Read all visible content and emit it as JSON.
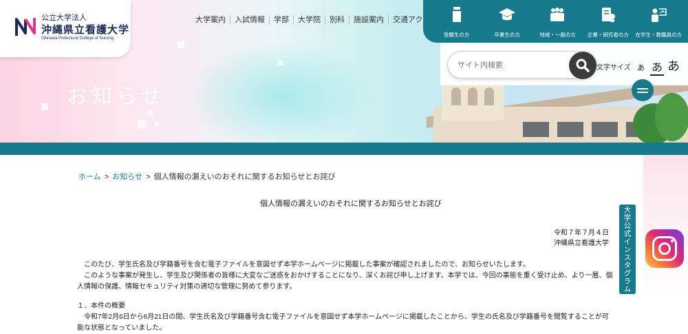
{
  "logo": {
    "corp": "公立大学法人",
    "name": "沖縄県立看護大学",
    "english": "Okinawa Prefectural College of Nursing"
  },
  "global_nav": [
    {
      "label": "大学案内"
    },
    {
      "label": "入試情報"
    },
    {
      "label": "学部"
    },
    {
      "label": "大学院"
    },
    {
      "label": "別科"
    },
    {
      "label": "施設案内"
    },
    {
      "label": "交通アクセス"
    }
  ],
  "targets": [
    {
      "label": "受験生の方",
      "icon": "student-icon"
    },
    {
      "label": "卒業生の方",
      "icon": "graduation-cap-icon"
    },
    {
      "label": "地域・一般の方",
      "icon": "people-icon"
    },
    {
      "label": "企業・研究者の方",
      "icon": "researcher-icon"
    },
    {
      "label": "在学生・教職員の方",
      "icon": "teacher-icon"
    }
  ],
  "search": {
    "placeholder": "サイト内検索",
    "button_icon": "search-icon"
  },
  "font_size": {
    "label": "文字サイズ",
    "small": "あ",
    "medium": "あ",
    "large": "あ",
    "selected": "medium"
  },
  "hero": {
    "title": "お知らせ"
  },
  "breadcrumb": {
    "home": "ホーム",
    "news": "お知らせ",
    "current": "個人情報の漏えいのおそれに関するお知らせとお詫び",
    "separator": ">"
  },
  "article": {
    "title": "個人情報の漏えいのおそれに関するお知らせとお詫び",
    "date": "令和７年７月４日",
    "author": "沖縄県立看護大学",
    "para1": "　このたび、学生氏名及び学籍番号を含む電子ファイルを意図せず本学ホームページに掲載した事案が確認されましたので、お知らせいたします。",
    "para2": "　このような事案が発生し、学生及び関係者の皆様に大変なご迷惑をおかけすることになり、深くお詫び申し上げます。本学では、今回の事態を重く受け止め、より一層、個人情報の保護、情報セキュリティ対策の適切な管理に努めて参ります。",
    "section1_heading": "１．本件の概要",
    "section1_body": "　令和7年2月6日から6月21日の間、学生氏名及び学籍番号含む電子ファイルを意図せず本学ホームページに掲載したことから、学生の氏名及び学籍番号を閲覧することが可能な状態となっていました。"
  },
  "side": {
    "instagram_tab": "大学公式インスタグラム",
    "instagram_icon": "instagram-icon"
  },
  "colors": {
    "brand_teal": "#167a8c",
    "hero_pink": "#fbd3e2",
    "hero_cyan": "#c6eef0"
  }
}
